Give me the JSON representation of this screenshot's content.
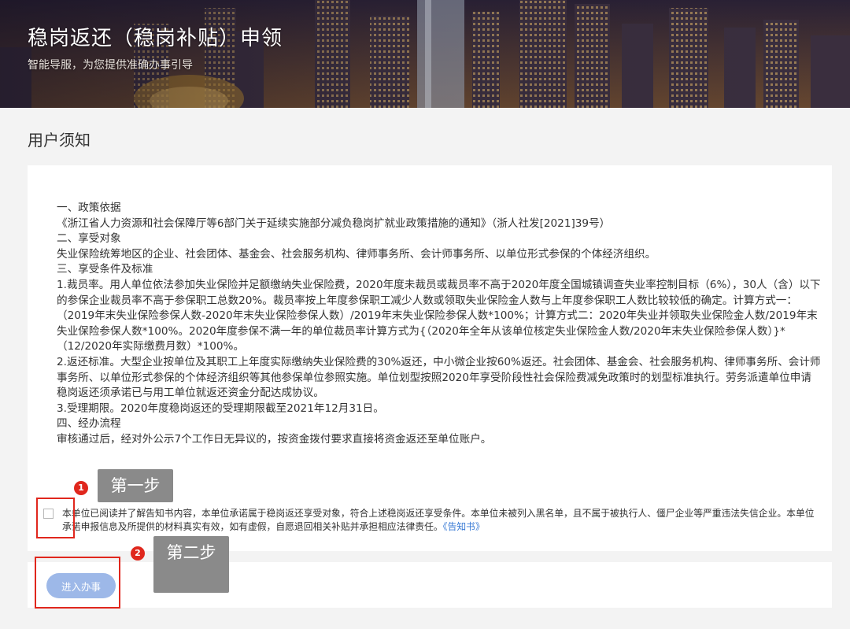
{
  "header": {
    "title": "稳岗返还（稳岗补贴）申领",
    "subtitle": "智能导服，为您提供准确办事引导"
  },
  "notice": {
    "section_title": "用户须知",
    "lines": [
      "一、政策依据",
      "《浙江省人力资源和社会保障厅等6部门关于延续实施部分减负稳岗扩就业政策措施的通知》（浙人社发[2021]39号）",
      "二、享受对象",
      "失业保险统筹地区的企业、社会团体、基金会、社会服务机构、律师事务所、会计师事务所、以单位形式参保的个体经济组织。",
      "三、享受条件及标准",
      "1.裁员率。用人单位依法参加失业保险并足额缴纳失业保险费，2020年度未裁员或裁员率不高于2020年度全国城镇调查失业率控制目标（6%），30人（含）以下的参保企业裁员率不高于参保职工总数20%。裁员率按上年度参保职工减少人数或领取失业保险金人数与上年度参保职工人数比较较低的确定。计算方式一：（2019年末失业保险参保人数-2020年末失业保险参保人数）/2019年末失业保险参保人数*100%；计算方式二：2020年失业并领取失业保险金人数/2019年末失业保险参保人数*100%。2020年度参保不满一年的单位裁员率计算方式为{（2020年全年从该单位核定失业保险金人数/2020年末失业保险参保人数）}*（12/2020年实际缴费月数）*100%。",
      "2.返还标准。大型企业按单位及其职工上年度实际缴纳失业保险费的30%返还，中小微企业按60%返还。社会团体、基金会、社会服务机构、律师事务所、会计师事务所、以单位形式参保的个体经济组织等其他参保单位参照实施。单位划型按照2020年享受阶段性社会保险费减免政策时的划型标准执行。劳务派遣单位申请稳岗返还须承诺已与用工单位就返还资金分配达成协议。",
      "3.受理期限。2020年度稳岗返还的受理期限截至2021年12月31日。",
      "四、经办流程",
      "审核通过后，经对外公示7个工作日无异议的，按资金拨付要求直接将资金返还至单位账户。"
    ]
  },
  "agreement": {
    "checked": false,
    "text": "本单位已阅读并了解告知书内容，本单位承诺属于稳岗返还享受对象，符合上述稳岗返还享受条件。本单位未被列入黑名单，且不属于被执行人、僵尸企业等严重违法失信企业。本单位承诺申报信息及所提供的材料真实有效，如有虚假，自愿退回相关补贴并承担相应法律责任。",
    "link_label": "《告知书》"
  },
  "actions": {
    "enter_label": "进入办事"
  },
  "annotations": {
    "step1_number": "1",
    "step1_label": "第一步",
    "step2_number": "2",
    "step2_label": "第二步",
    "highlight_color": "#e0271d"
  },
  "colors": {
    "button": "#9db8e8",
    "link": "#3a7bd5",
    "page_bg": "#f3f3f3"
  }
}
